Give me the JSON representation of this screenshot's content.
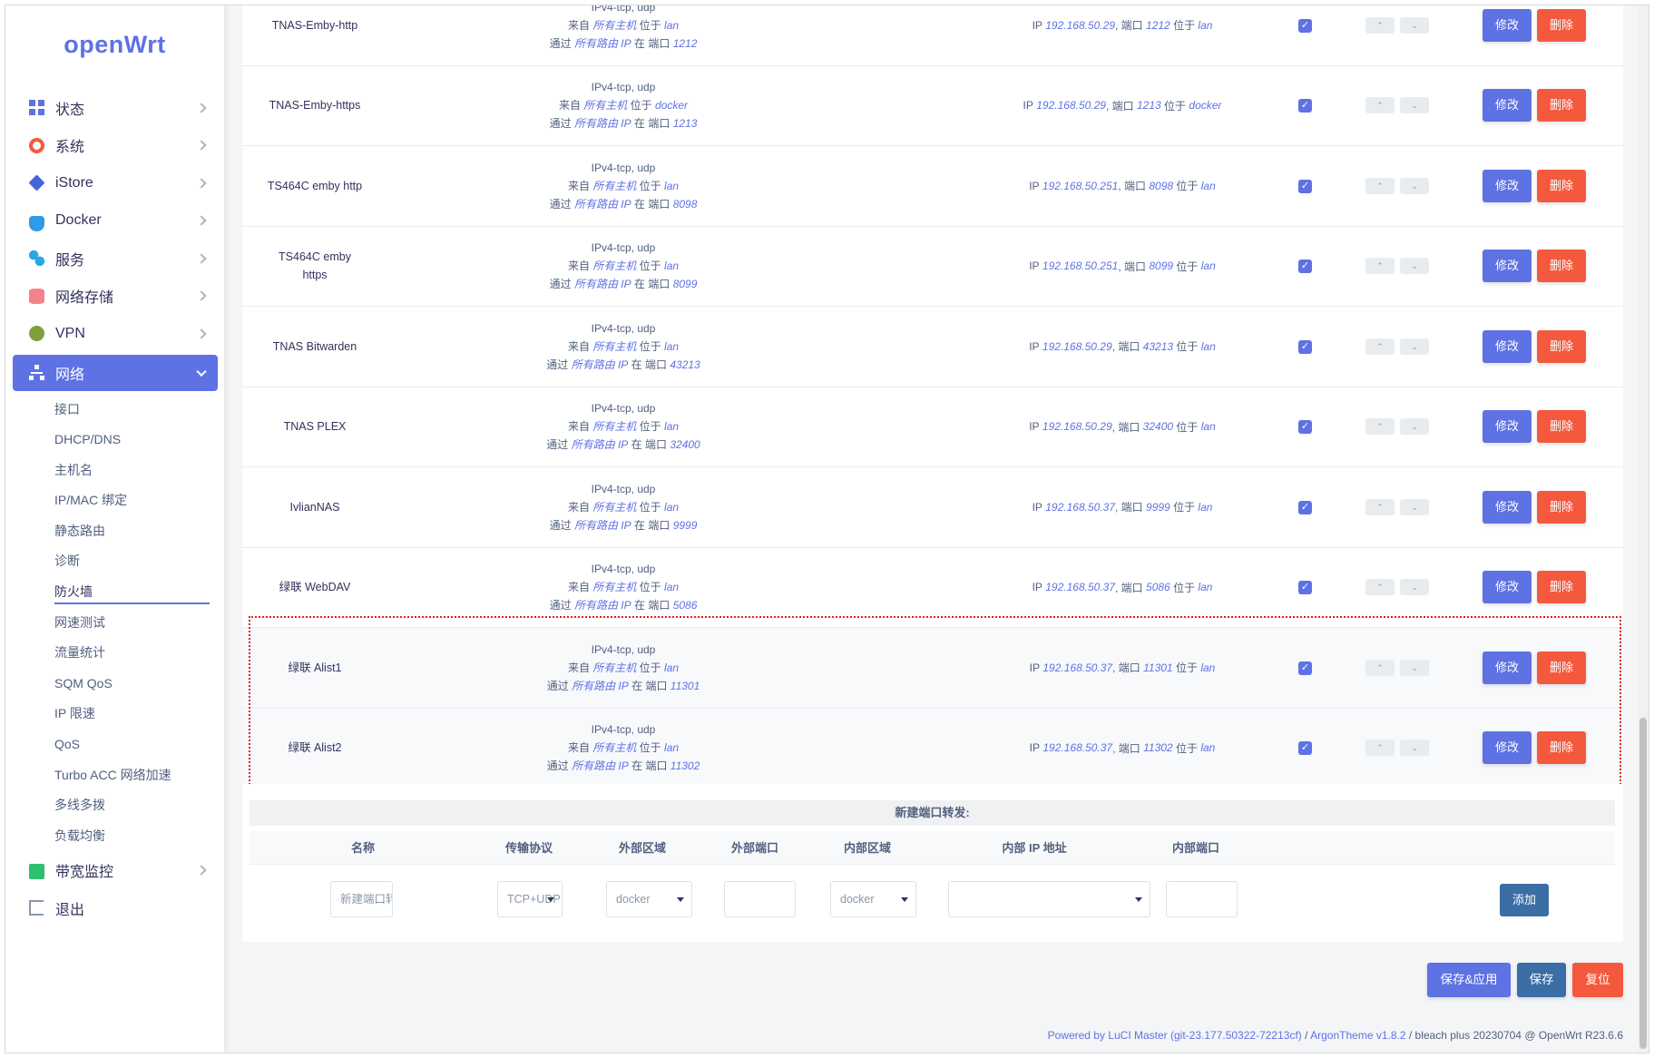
{
  "app": {
    "logo": "openWrt"
  },
  "sidebar": {
    "items": [
      {
        "label": "状态",
        "icon": "dashboard-icon"
      },
      {
        "label": "系统",
        "icon": "gear-icon"
      },
      {
        "label": "iStore",
        "icon": "box-icon"
      },
      {
        "label": "Docker",
        "icon": "docker-icon"
      },
      {
        "label": "服务",
        "icon": "services-icon"
      },
      {
        "label": "网络存储",
        "icon": "storage-icon"
      },
      {
        "label": "VPN",
        "icon": "vpn-icon"
      },
      {
        "label": "网络",
        "icon": "network-icon"
      }
    ],
    "network_sub": [
      "接口",
      "DHCP/DNS",
      "主机名",
      "IP/MAC 绑定",
      "静态路由",
      "诊断",
      "防火墙",
      "网速测试",
      "流量统计",
      "SQM QoS",
      "IP 限速",
      "QoS",
      "Turbo ACC 网络加速",
      "多线多拨",
      "负载均衡"
    ],
    "bottom_items": [
      {
        "label": "带宽监控",
        "icon": "monitor-icon"
      },
      {
        "label": "退出",
        "icon": "logout-icon"
      }
    ]
  },
  "text": {
    "from": "来自",
    "at": "位于",
    "via": "通过",
    "at_port": "在 端口",
    "port": ", 端口",
    "any_host": "所有主机",
    "any_router_ip": "所有路由 IP",
    "ip": "IP",
    "edit": "修改",
    "delete": "删除"
  },
  "rules": [
    {
      "name": "TNAS-Emby-http",
      "proto": "IPv4-tcp, udp",
      "src": "lan",
      "src_port": "1212",
      "dest_ip": "192.168.50.29",
      "dest_port": "1212",
      "dest": "lan"
    },
    {
      "name": "TNAS-Emby-https",
      "proto": "IPv4-tcp, udp",
      "src": "docker",
      "src_port": "1213",
      "dest_ip": "192.168.50.29",
      "dest_port": "1213",
      "dest": "docker"
    },
    {
      "name": "TS464C emby http",
      "proto": "IPv4-tcp, udp",
      "src": "lan",
      "src_port": "8098",
      "dest_ip": "192.168.50.251",
      "dest_port": "8098",
      "dest": "lan"
    },
    {
      "name": "TS464C emby https",
      "proto": "IPv4-tcp, udp",
      "src": "lan",
      "src_port": "8099",
      "dest_ip": "192.168.50.251",
      "dest_port": "8099",
      "dest": "lan"
    },
    {
      "name": "TNAS Bitwarden",
      "proto": "IPv4-tcp, udp",
      "src": "lan",
      "src_port": "43213",
      "dest_ip": "192.168.50.29",
      "dest_port": "43213",
      "dest": "lan"
    },
    {
      "name": "TNAS PLEX",
      "proto": "IPv4-tcp, udp",
      "src": "lan",
      "src_port": "32400",
      "dest_ip": "192.168.50.29",
      "dest_port": "32400",
      "dest": "lan"
    },
    {
      "name": "IvlianNAS",
      "proto": "IPv4-tcp, udp",
      "src": "lan",
      "src_port": "9999",
      "dest_ip": "192.168.50.37",
      "dest_port": "9999",
      "dest": "lan"
    },
    {
      "name": "绿联 WebDAV",
      "proto": "IPv4-tcp, udp",
      "src": "lan",
      "src_port": "5086",
      "dest_ip": "192.168.50.37",
      "dest_port": "5086",
      "dest": "lan"
    },
    {
      "name": "绿联 Alist1",
      "proto": "IPv4-tcp, udp",
      "src": "lan",
      "src_port": "11301",
      "dest_ip": "192.168.50.37",
      "dest_port": "11301",
      "dest": "lan"
    },
    {
      "name": "绿联 Alist2",
      "proto": "IPv4-tcp, udp",
      "src": "lan",
      "src_port": "11302",
      "dest_ip": "192.168.50.37",
      "dest_port": "11302",
      "dest": "lan"
    }
  ],
  "new_rule": {
    "title": "新建端口转发:",
    "headers": [
      "名称",
      "传输协议",
      "外部区域",
      "外部端口",
      "内部区域",
      "内部 IP 地址",
      "内部端口"
    ],
    "name_placeholder": "新建端口转",
    "proto_value": "TCP+UDP",
    "ext_zone_value": "docker",
    "int_zone_value": "docker",
    "int_ip_value": "",
    "ext_port_value": "",
    "int_port_value": "",
    "add_label": "添加"
  },
  "actions": {
    "save_apply": "保存&应用",
    "save": "保存",
    "reset": "复位"
  },
  "footer": {
    "luci": "Powered by LuCI Master (git-23.177.50322-72213cf)",
    "sep1": " / ",
    "theme": "ArgonTheme v1.8.2",
    "sep2": " / ",
    "build": "bleach plus 20230704 @ OpenWrt R23.6.6"
  }
}
